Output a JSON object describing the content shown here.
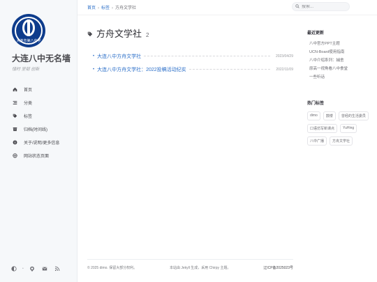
{
  "site": {
    "avatar_text": "大连市第八中学",
    "title": "大连八中无名墙",
    "subtitle": "惜时 坚韧 创新"
  },
  "nav": {
    "items": [
      {
        "label": "首页",
        "icon": "home-icon"
      },
      {
        "label": "分类",
        "icon": "stream-icon"
      },
      {
        "label": "标签",
        "icon": "tags-icon"
      },
      {
        "label": "归档(时间线)",
        "icon": "archive-icon"
      },
      {
        "label": "关于/说明/更多信息",
        "icon": "info-icon"
      },
      {
        "label": "网站状态页面",
        "icon": "globe-icon"
      }
    ]
  },
  "bottom_icons": [
    "theme-toggle-icon",
    "github-icon",
    "email-icon",
    "rss-icon"
  ],
  "breadcrumb": {
    "home": "首页",
    "tags": "标签",
    "current": "方舟文学社"
  },
  "search": {
    "placeholder": "搜索..."
  },
  "page": {
    "title": "方舟文学社",
    "count": "2",
    "posts": [
      {
        "title": "大连八中方舟文学社",
        "date": "2023/04/29"
      },
      {
        "title": "大连八中方舟文学社：2022投稿活动纪实",
        "date": "2022/11/09"
      }
    ]
  },
  "recent_updates": {
    "heading": "最近更新",
    "items": [
      "八中官方PPT主题",
      "UCN-Board使用指南",
      "八中介绍系列：捕舍",
      "原高一视角看八中食堂",
      "一些听话"
    ]
  },
  "trending_tags": {
    "heading": "热门标签",
    "tags": [
      "dimo",
      "鼓楼",
      "曾经的生活委员",
      "口语仿写新课点",
      "YuHing",
      "八中广播",
      "方舟文学社"
    ]
  },
  "footer": {
    "copyright": "© 2025 dimo. 保留大部分权利。",
    "powered": "本站由 Jekyll 生成，采用 Chirpy 主题。",
    "icp": "辽ICP备2025023号"
  },
  "colors": {
    "link": "#2a6ec8",
    "sidebar_bg": "#f6f8fa",
    "avatar_bg": "#0e3c8c"
  }
}
